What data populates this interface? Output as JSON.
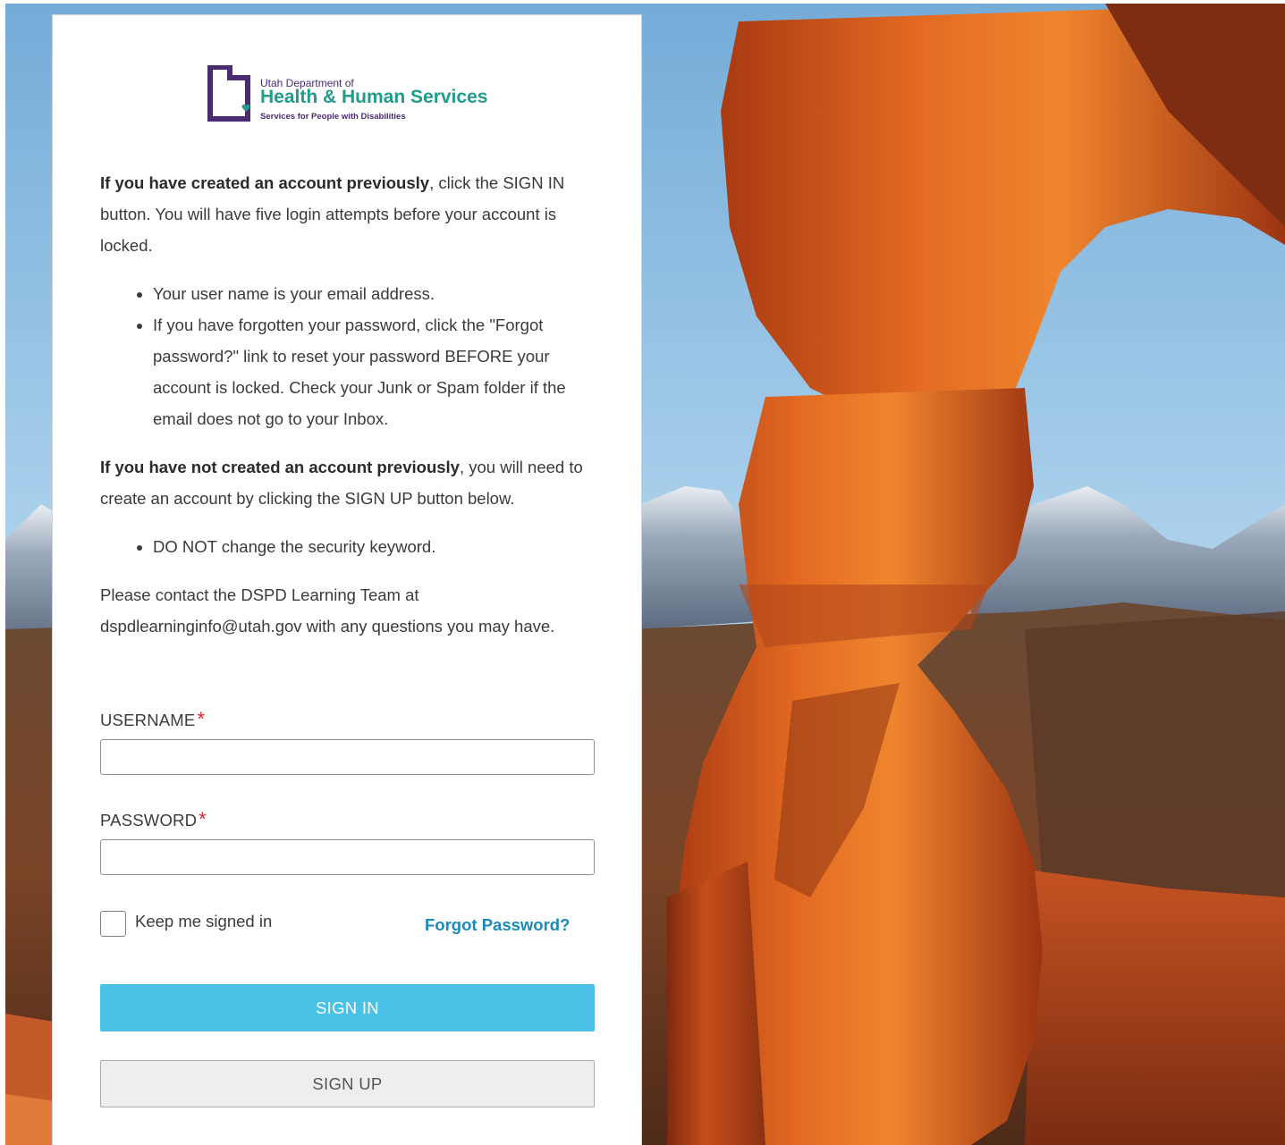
{
  "branding": {
    "org_small": "Utah Department of",
    "org_name": "Health & Human Services",
    "org_division": "Services for People with Disabilities",
    "brand_purple": "#4a2a70",
    "brand_teal": "#1f9c8a"
  },
  "intro": {
    "p1_bold": "If you have created an account previously",
    "p1_rest": ", click the SIGN IN button. You will have five login attempts before your account is locked.",
    "bullets1": [
      "Your user name is your email address.",
      "If you have forgotten your password, click the \"Forgot password?\" link to reset your password BEFORE your account is locked. Check your Junk or Spam folder if the email does not go to your Inbox."
    ],
    "p2_bold": "If you have not created an account previously",
    "p2_rest": ", you will need to create an account by clicking the SIGN UP button below.",
    "bullets2": [
      "DO NOT change the security keyword."
    ],
    "p3": "Please contact the DSPD Learning Team at dspdlearninginfo@utah.gov with any questions you may have."
  },
  "form": {
    "username_label": "USERNAME",
    "username_value": "",
    "password_label": "PASSWORD",
    "password_value": "",
    "required_mark": "*",
    "keep_signed_in": "Keep me signed in",
    "forgot_password": "Forgot Password?",
    "sign_in": "SIGN IN",
    "sign_up": "SIGN UP"
  },
  "colors": {
    "primary_button": "#4cc1e8",
    "link": "#1a8ab8",
    "required": "#e0222a"
  },
  "icons": {
    "logo": "utah-state-outline-icon",
    "heart": "heart-icon"
  }
}
